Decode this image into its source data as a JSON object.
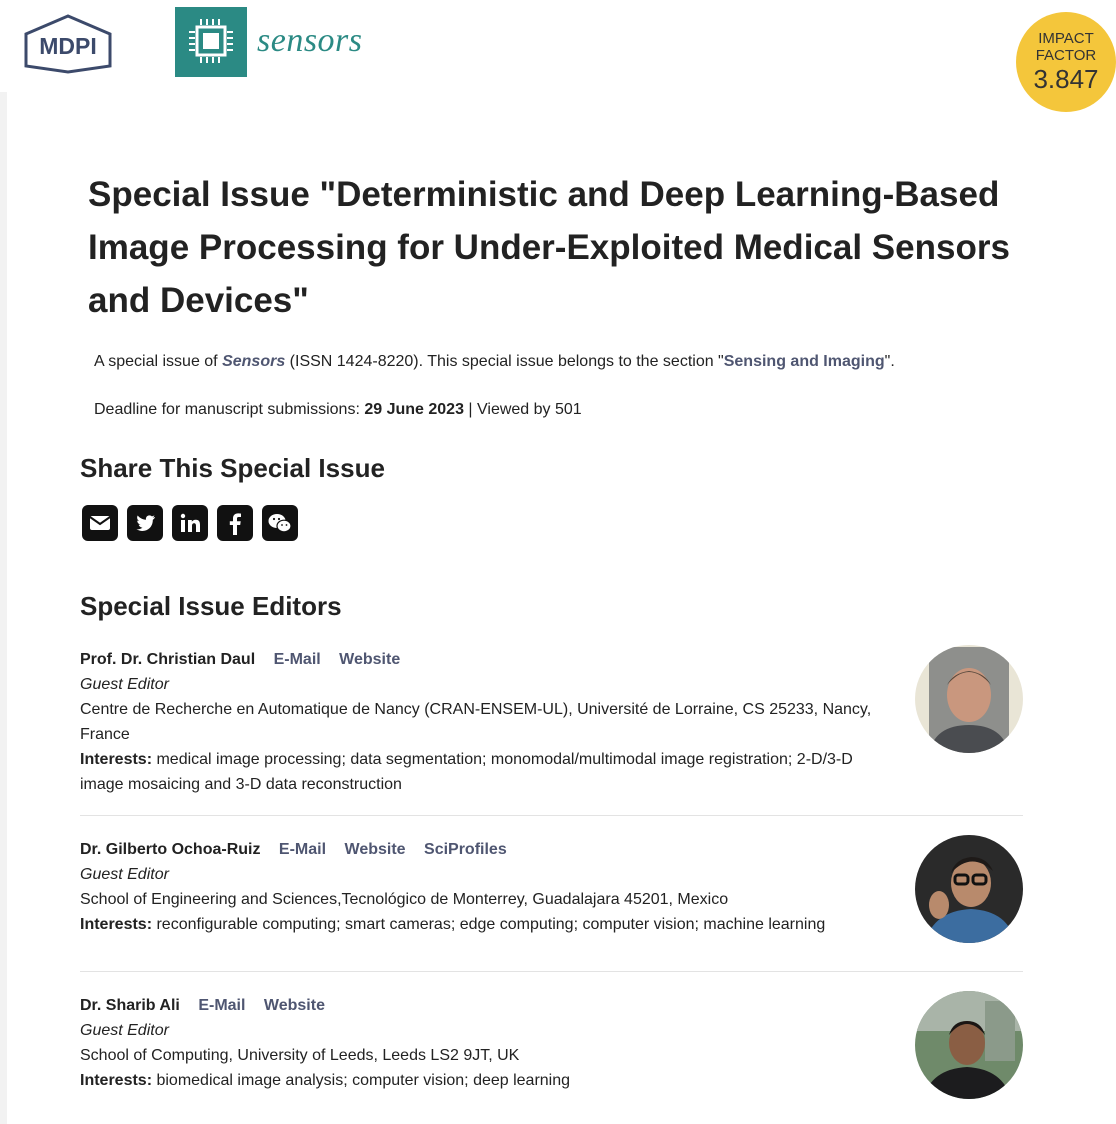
{
  "header": {
    "publisher_logo_text": "MDPI",
    "journal_logo_icon": "chip-icon",
    "journal_name": "sensors",
    "impact_factor_label": "IMPACT FACTOR",
    "impact_factor_value": "3.847"
  },
  "title": "Special Issue \"Deterministic and Deep Learning-Based Image Processing for Under-Exploited Medical Sensors and Devices\"",
  "intro": {
    "prefix": "A special issue of ",
    "journal": "Sensors",
    "issn": " (ISSN 1424-8220). This special issue belongs to the section \"",
    "section": "Sensing and Imaging",
    "suffix": "\"."
  },
  "deadline": {
    "label": "Deadline for manuscript submissions: ",
    "date": "29 June 2023",
    "views": " | Viewed by 501"
  },
  "share": {
    "heading": "Share This Special Issue",
    "icons": [
      "envelope-icon",
      "twitter-icon",
      "linkedin-icon",
      "facebook-icon",
      "wechat-icon"
    ]
  },
  "editors": {
    "heading": "Special Issue Editors",
    "items": [
      {
        "name": "Prof. Dr. Christian Daul",
        "links": [
          "E-Mail",
          "Website"
        ],
        "role": "Guest Editor",
        "affiliation": "Centre de Recherche en Automatique de Nancy (CRAN-ENSEM-UL), Université de Lorraine, CS 25233, Nancy, France",
        "interests_label": "Interests:",
        "interests": " medical image processing; data segmentation; monomodal/multimodal image registration; 2-D/3-D image mosaicing and 3-D data reconstruction"
      },
      {
        "name": "Dr. Gilberto Ochoa-Ruiz",
        "links": [
          "E-Mail",
          "Website",
          "SciProfiles"
        ],
        "role": "Guest Editor",
        "affiliation": "School of Engineering and Sciences,Tecnológico de Monterrey, Guadalajara 45201, Mexico",
        "interests_label": "Interests:",
        "interests": " reconfigurable computing; smart cameras; edge computing; computer vision; machine learning"
      },
      {
        "name": "Dr. Sharib Ali",
        "links": [
          "E-Mail",
          "Website"
        ],
        "role": "Guest Editor",
        "affiliation": "School of Computing, University of Leeds, Leeds LS2 9JT, UK",
        "interests_label": "Interests:",
        "interests": " biomedical image analysis; computer vision; deep learning"
      }
    ]
  }
}
